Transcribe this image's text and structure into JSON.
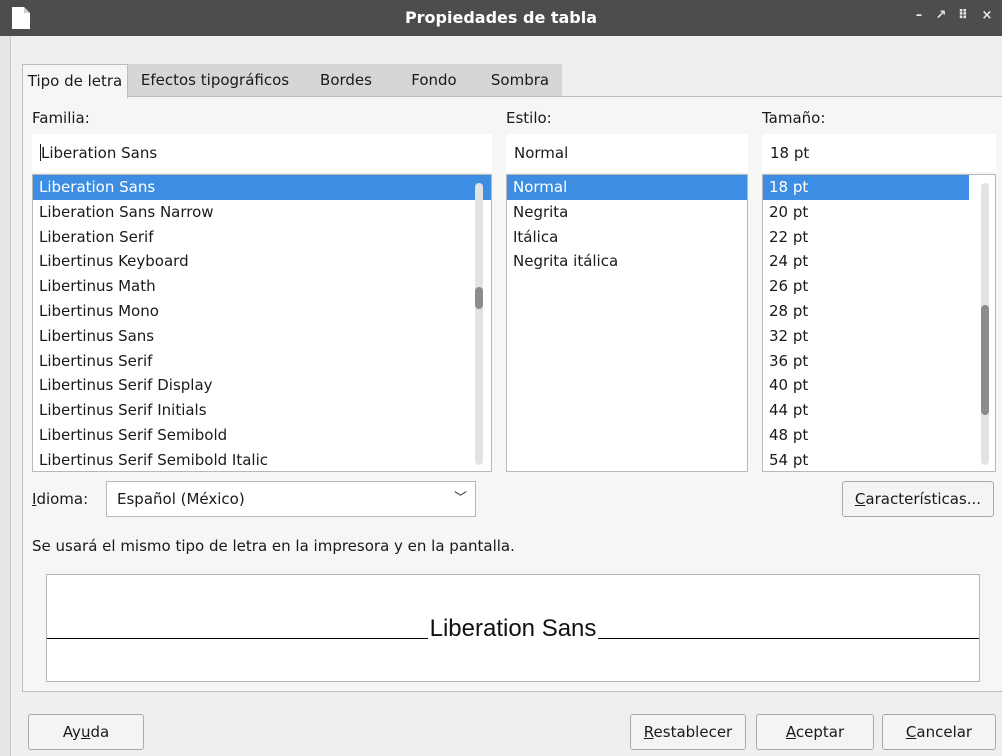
{
  "window": {
    "title": "Propiedades de tabla",
    "controls": [
      "–",
      "↗",
      "⠿",
      "×"
    ]
  },
  "tabs": [
    {
      "label": "Tipo de letra",
      "active": true
    },
    {
      "label": "Efectos tipográficos",
      "active": false
    },
    {
      "label": "Bordes",
      "active": false
    },
    {
      "label": "Fondo",
      "active": false
    },
    {
      "label": "Sombra",
      "active": false
    }
  ],
  "family": {
    "label": "Familia:",
    "value": "Liberation Sans",
    "items": [
      "Liberation Sans",
      "Liberation Sans Narrow",
      "Liberation Serif",
      "Libertinus Keyboard",
      "Libertinus Math",
      "Libertinus Mono",
      "Libertinus Sans",
      "Libertinus Serif",
      "Libertinus Serif Display",
      "Libertinus Serif Initials",
      "Libertinus Serif Semibold",
      "Libertinus Serif Semibold Italic"
    ]
  },
  "style": {
    "label": "Estilo:",
    "value": "Normal",
    "items": [
      "Normal",
      "Negrita",
      "Itálica",
      "Negrita itálica"
    ]
  },
  "size": {
    "label": "Tamaño:",
    "value": "18 pt",
    "items": [
      "18 pt",
      "20 pt",
      "22 pt",
      "24 pt",
      "26 pt",
      "28 pt",
      "32 pt",
      "36 pt",
      "40 pt",
      "44 pt",
      "48 pt",
      "54 pt"
    ]
  },
  "language": {
    "label_prefix": "I",
    "label_rest": "dioma:",
    "value": "Español (México)"
  },
  "features_button": {
    "mnemonic": "C",
    "rest": "aracterísticas..."
  },
  "info_text": "Se usará el mismo tipo de letra en la impresora y en la pantalla.",
  "preview": {
    "text": "Liberation Sans"
  },
  "buttons": {
    "help": {
      "pre": "Ay",
      "mnemonic": "u",
      "post": "da"
    },
    "reset": {
      "mnemonic": "R",
      "rest": "establecer"
    },
    "ok": {
      "mnemonic": "A",
      "rest": "ceptar"
    },
    "cancel": {
      "mnemonic": "C",
      "rest": "ancelar"
    }
  },
  "colors": {
    "titlebar": "#4d4d4d",
    "selection": "#3d8ee2",
    "dialog_bg": "#efefef"
  }
}
